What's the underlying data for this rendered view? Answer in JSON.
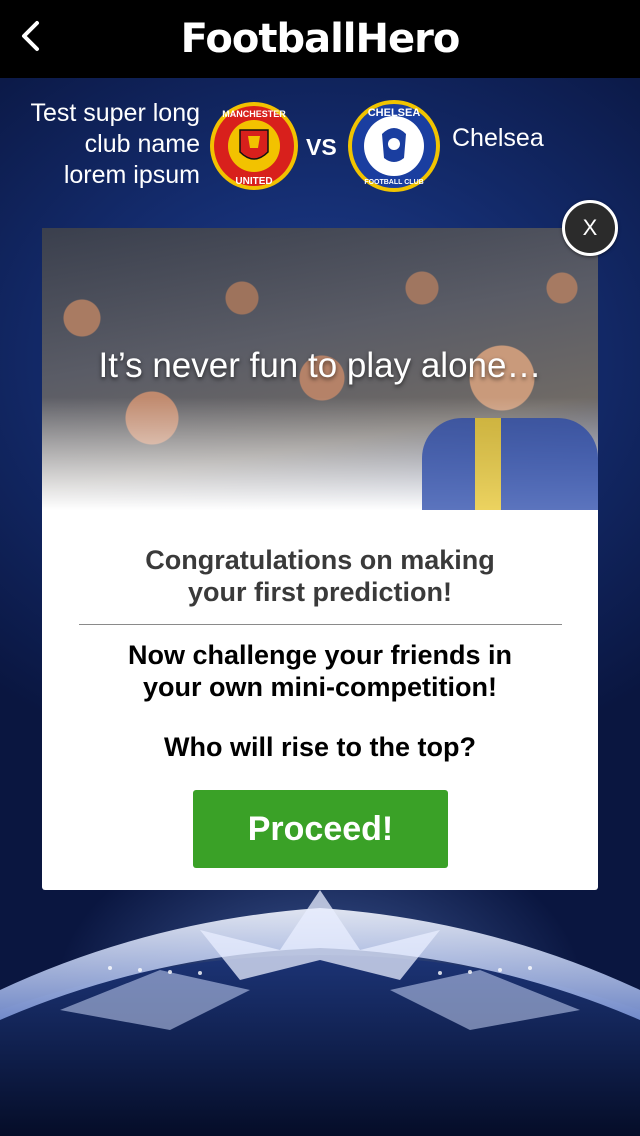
{
  "app": {
    "title": "FootballHero"
  },
  "nav": {
    "back_icon": "chevron-left-icon"
  },
  "match": {
    "home_team": "Test super long\nclub name\nlorem ipsum",
    "home_line1": "Test super long",
    "home_line2": "club name",
    "home_line3": "lorem ipsum",
    "home_crest": {
      "top_text": "MANCHESTER",
      "bottom_text": "UNITED",
      "color": "#d8201c"
    },
    "vs_label": "VS",
    "away_team": "Chelsea",
    "away_crest": {
      "top_text": "CHELSEA",
      "bottom_text": "FOOTBALL CLUB",
      "color": "#1a3ea0"
    }
  },
  "modal": {
    "close_label": "X",
    "hero_text": "It’s never fun to play alone…",
    "congrats_line1": "Congratulations on making",
    "congrats_line2": "your first prediction!",
    "challenge_line1": "Now challenge your friends in",
    "challenge_line2": "your own mini-competition!",
    "rise_text": "Who will rise to the top?",
    "proceed_label": "Proceed!",
    "proceed_color": "#3aa127"
  }
}
